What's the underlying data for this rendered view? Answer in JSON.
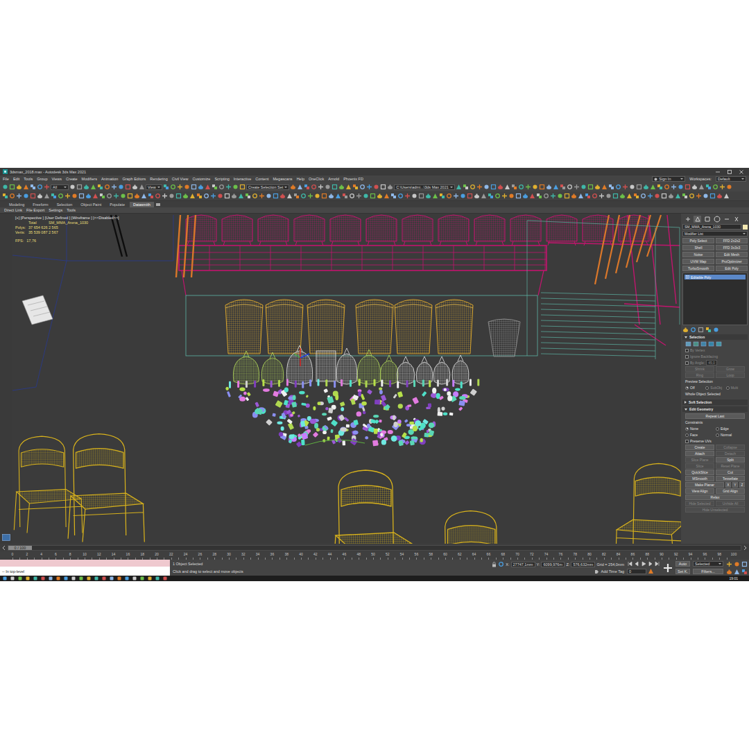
{
  "window": {
    "title": "3dsmax_2018.max - Autodesk 3ds Max 2021"
  },
  "menu": [
    "File",
    "Edit",
    "Tools",
    "Group",
    "Views",
    "Create",
    "Modifiers",
    "Animation",
    "Graph Editors",
    "Rendering",
    "Civil View",
    "Customize",
    "Scripting",
    "Interactive",
    "Content",
    "Megascans",
    "Help",
    "OneClick",
    "Arnold",
    "Phoenix FD"
  ],
  "account": {
    "sign_in": "Sign In",
    "workspaces_label": "Workspaces:",
    "workspace": "Default"
  },
  "toolbar": {
    "filter": "All",
    "reference_coord": "View",
    "selection_set": "Create Selection Set",
    "project_path": "C:\\Users\\admi...\\3ds Max 2021"
  },
  "ribbon": {
    "tabs": [
      {
        "label": "Modeling",
        "selected": false
      },
      {
        "label": "Freeform",
        "selected": false
      },
      {
        "label": "Selection",
        "selected": false
      },
      {
        "label": "Object Paint",
        "selected": false
      },
      {
        "label": "Populate",
        "selected": false
      },
      {
        "label": "Datasmith",
        "selected": true
      }
    ],
    "subtabs": [
      "Direct Link",
      "File Export",
      "Settings",
      "Tools"
    ]
  },
  "viewport": {
    "label": "[+] [Perspective ] [User Defined ] [Wireframe ] [<<Disabled>>]",
    "stats": {
      "header": [
        "Total",
        "SM_MMA_Arena_1030"
      ],
      "rows": [
        {
          "label": "Polys:",
          "total": "37 654 626",
          "selection": "2 565"
        },
        {
          "label": "Verts:",
          "total": "35 539 087",
          "selection": "2 567"
        }
      ],
      "fps": {
        "label": "FPS:",
        "value": "17,76"
      }
    }
  },
  "command_panel": {
    "tabs": [
      {
        "selected": false
      },
      {
        "selected": true
      },
      {
        "selected": false
      },
      {
        "selected": false
      },
      {
        "selected": false
      },
      {
        "selected": false
      }
    ],
    "object_name": "SM_MMA_Arena_1030",
    "modifier_list": "Modifier List",
    "modifier_buttons": [
      "Poly Select",
      "FFD 2x2x2",
      "Shell",
      "FFD 3x3x3",
      "Noise",
      "Edit Mesh",
      "UVW Map",
      "ProOptimizer",
      "TurboSmooth",
      "Edit Poly"
    ],
    "stack": [
      {
        "label": "Editable Poly",
        "selected": true
      }
    ],
    "rollouts": [
      {
        "title": "Selection",
        "expanded": true,
        "rows": [
          [
            {
              "kind": "icon-row"
            }
          ],
          [
            {
              "kind": "checkbox",
              "label": "By Vertex",
              "checked": false,
              "disabled": true
            }
          ],
          [
            {
              "kind": "checkbox",
              "label": "Ignore Backfacing",
              "checked": false,
              "disabled": true
            }
          ],
          [
            {
              "kind": "checkbox",
              "label": "By Angle:",
              "checked": false,
              "disabled": true
            },
            {
              "kind": "spinner",
              "value": "45,0",
              "disabled": true
            }
          ],
          [
            {
              "kind": "button",
              "label": "Shrink",
              "disabled": true
            },
            {
              "kind": "button",
              "label": "Grow",
              "disabled": true
            }
          ],
          [
            {
              "kind": "button",
              "label": "Ring",
              "disabled": true
            },
            {
              "kind": "button",
              "label": "Loop",
              "disabled": true
            }
          ],
          [
            {
              "kind": "text",
              "label": "Preview Selection",
              "disabled": false
            }
          ],
          [
            {
              "kind": "radio",
              "label": "Off",
              "checked": true,
              "disabled": false
            },
            {
              "kind": "radio",
              "label": "SubObj",
              "checked": false,
              "disabled": true
            },
            {
              "kind": "radio",
              "label": "Multi",
              "checked": false,
              "disabled": true
            }
          ],
          [
            {
              "kind": "text",
              "label": "Whole Object Selected",
              "disabled": false
            }
          ]
        ]
      },
      {
        "title": "Soft Selection",
        "expanded": false,
        "rows": []
      },
      {
        "title": "Edit Geometry",
        "expanded": true,
        "rows": [
          [
            {
              "kind": "button",
              "label": "Repeat Last",
              "disabled": false
            }
          ],
          [
            {
              "kind": "text",
              "label": "Constraints",
              "disabled": false
            }
          ],
          [
            {
              "kind": "radio",
              "label": "None",
              "checked": true,
              "disabled": false
            },
            {
              "kind": "radio",
              "label": "Edge",
              "checked": false,
              "disabled": false
            }
          ],
          [
            {
              "kind": "radio",
              "label": "Face",
              "checked": false,
              "disabled": false
            },
            {
              "kind": "radio",
              "label": "Normal",
              "checked": false,
              "disabled": false
            }
          ],
          [
            {
              "kind": "checkbox",
              "label": "Preserve UVs",
              "checked": false,
              "disabled": false
            }
          ],
          [
            {
              "kind": "button",
              "label": "Create",
              "disabled": false
            },
            {
              "kind": "button",
              "label": "Collapse",
              "disabled": true
            }
          ],
          [
            {
              "kind": "button",
              "label": "Attach",
              "disabled": false
            },
            {
              "kind": "button",
              "label": "Detach",
              "disabled": true
            }
          ],
          [
            {
              "kind": "button",
              "label": "Slice Plane",
              "disabled": true
            },
            {
              "kind": "button",
              "label": "Split",
              "disabled": false
            }
          ],
          [
            {
              "kind": "button",
              "label": "Slice",
              "disabled": true
            },
            {
              "kind": "button",
              "label": "Reset Plane",
              "disabled": true
            }
          ],
          [
            {
              "kind": "button",
              "label": "QuickSlice",
              "disabled": false
            },
            {
              "kind": "button",
              "label": "Cut",
              "disabled": false
            }
          ],
          [
            {
              "kind": "button",
              "label": "MSmooth",
              "disabled": false
            },
            {
              "kind": "button",
              "label": "Tessellate",
              "disabled": false
            }
          ],
          [
            {
              "kind": "button",
              "label": "Make Planar",
              "disabled": false
            },
            {
              "kind": "button",
              "label": "X",
              "disabled": false
            },
            {
              "kind": "button",
              "label": "Y",
              "disabled": false
            },
            {
              "kind": "button",
              "label": "Z",
              "disabled": false
            }
          ],
          [
            {
              "kind": "button",
              "label": "View Align",
              "disabled": false
            },
            {
              "kind": "button",
              "label": "Grid Align",
              "disabled": false
            }
          ],
          [
            {
              "kind": "button",
              "label": "Relax",
              "disabled": false
            }
          ],
          [
            {
              "kind": "button",
              "label": "Hide Selected",
              "disabled": true
            },
            {
              "kind": "button",
              "label": "Unhide All",
              "disabled": true
            }
          ],
          [
            {
              "kind": "button",
              "label": "Hide Unselected",
              "disabled": true
            }
          ]
        ]
      }
    ]
  },
  "timeline": {
    "position": "0 / 100",
    "level": 0,
    "ticks": [
      "0",
      "2",
      "4",
      "6",
      "8",
      "10",
      "12",
      "14",
      "16",
      "18",
      "20",
      "22",
      "24",
      "26",
      "28",
      "30",
      "32",
      "34",
      "36",
      "38",
      "40",
      "42",
      "44",
      "46",
      "48",
      "50",
      "52",
      "54",
      "56",
      "58",
      "60",
      "62",
      "64",
      "66",
      "68",
      "70",
      "72",
      "74",
      "76",
      "78",
      "80",
      "82",
      "84",
      "86",
      "88",
      "90",
      "92",
      "94",
      "96",
      "98",
      "100"
    ]
  },
  "status": {
    "listener": "-- In top-level",
    "selection": "1 Object Selected",
    "prompt": "Click and drag to select and move objects",
    "coords": [
      {
        "axis": "X:",
        "value": "27747,1mm"
      },
      {
        "axis": "Y:",
        "value": "6099,976m"
      },
      {
        "axis": "Z:",
        "value": "576,632mm"
      }
    ],
    "grid": "Grid = 254,0mm",
    "time_tag": "Add Time Tag",
    "frame": "0",
    "auto_key": "Auto",
    "set_key": "Set K.",
    "key_mode": "Selected",
    "filters": "Filters..."
  },
  "taskbar": {
    "time": "19:01"
  }
}
